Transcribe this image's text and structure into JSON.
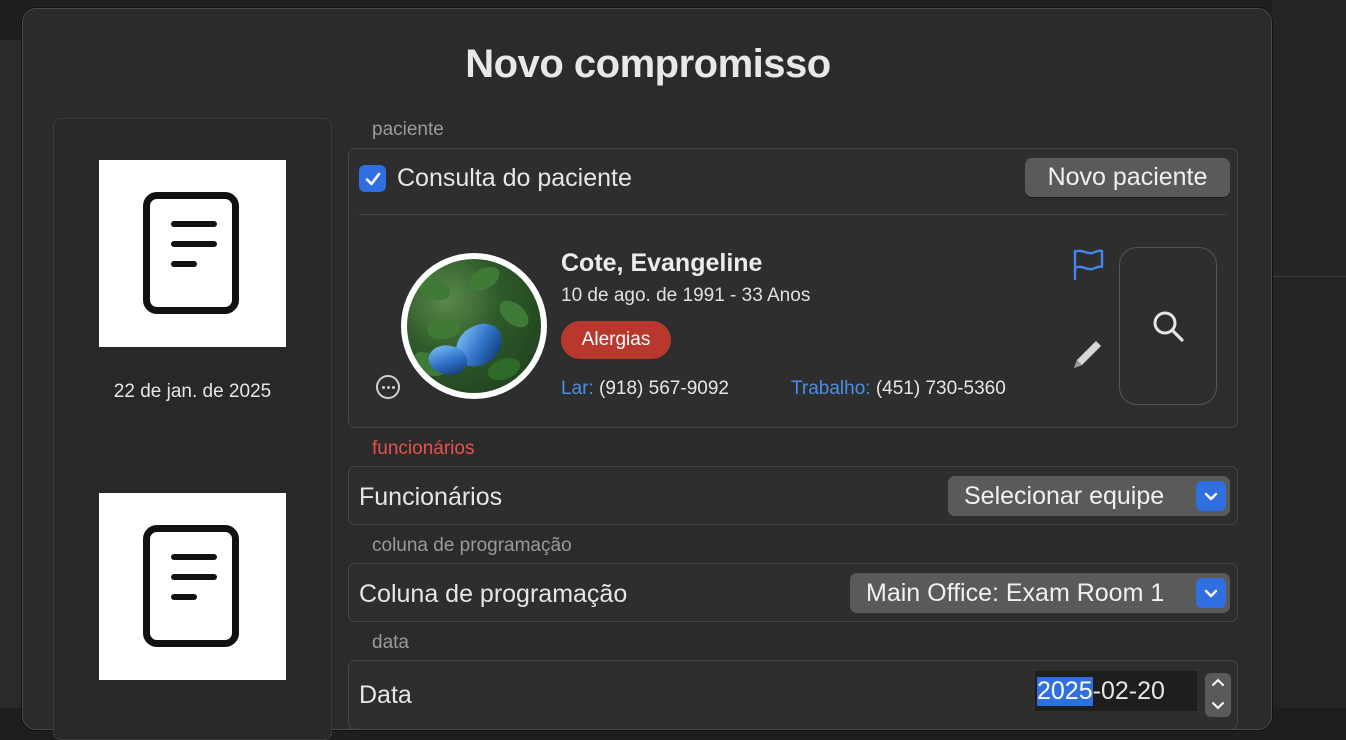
{
  "dialog": {
    "title": "Novo compromisso"
  },
  "left_panel": {
    "thumb_date": "22 de jan. de 2025"
  },
  "patient_section": {
    "label": "paciente",
    "checkbox_label": "Consulta do paciente",
    "checkbox_checked": true,
    "new_patient_button": "Novo paciente",
    "patient": {
      "name": "Cote, Evangeline",
      "dob_age": "10 de ago. de 1991 - 33 Anos",
      "allergy_badge": "Alergias",
      "home_label": "Lar:",
      "home_phone": "(918) 567-9092",
      "work_label": "Trabalho:",
      "work_phone": "(451) 730-5360"
    }
  },
  "staff_section": {
    "label": "funcionários",
    "field_label": "Funcionários",
    "popup_value": "Selecionar equipe"
  },
  "schedule_section": {
    "label": "coluna de programação",
    "field_label": "Coluna de programação",
    "popup_value": "Main Office: Exam Room 1"
  },
  "date_section": {
    "label": "data",
    "field_label": "Data",
    "year_selected": "2025",
    "rest": "-02-20"
  },
  "colors": {
    "accent": "#2f6fe0",
    "alert": "#b8382e",
    "link": "#4a8fe7",
    "section_red": "#e5534b"
  },
  "icons": [
    "document-icon",
    "ellipsis-circle-icon",
    "flag-icon",
    "pencil-icon",
    "magnifying-glass-icon",
    "chevron-down-icon",
    "stepper-icon"
  ]
}
